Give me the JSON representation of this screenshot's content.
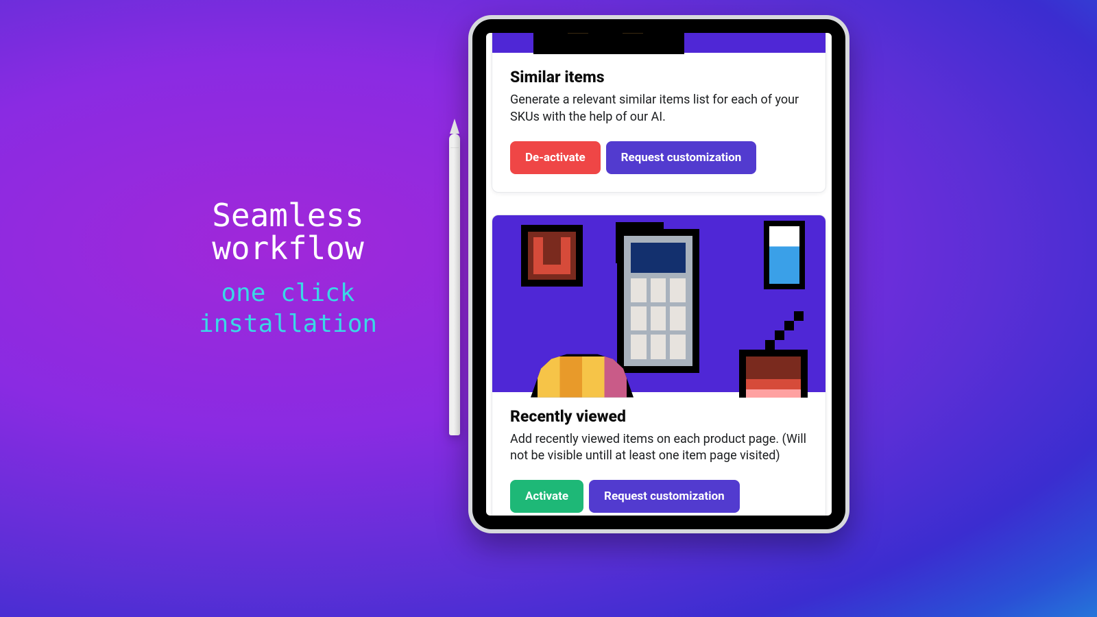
{
  "hero": {
    "title": "Seamless\nworkflow",
    "subtitle": "one click\ninstallation"
  },
  "cards": [
    {
      "title": "Similar items",
      "description": "Generate a relevant similar items list for each of your SKUs with the help of our AI.",
      "primary_label": "De-activate",
      "secondary_label": "Request customization"
    },
    {
      "title": "Recently viewed",
      "description": "Add recently viewed items on each product page. (Will not be visible untill at least one item page visited)",
      "primary_label": "Activate",
      "secondary_label": "Request customization"
    }
  ]
}
